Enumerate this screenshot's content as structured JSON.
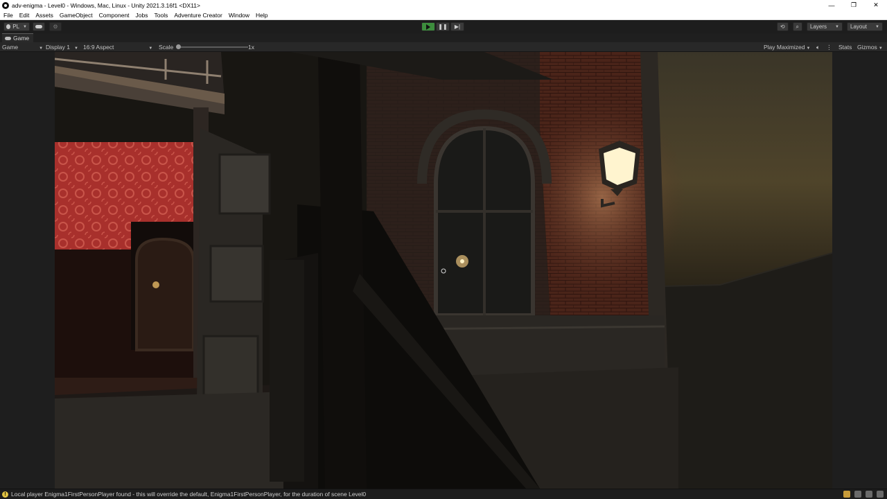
{
  "window": {
    "title": "adv-enigma - Level0 - Windows, Mac, Linux - Unity 2021.3.16f1 <DX11>",
    "controls": [
      "—",
      "❐",
      "✕"
    ]
  },
  "menu": [
    "File",
    "Edit",
    "Assets",
    "GameObject",
    "Component",
    "Jobs",
    "Tools",
    "Adventure Creator",
    "Window",
    "Help"
  ],
  "toolbar": {
    "account_label": "PL",
    "play_icon": "play-icon",
    "pause_icon": "pause-icon",
    "step_icon": "step-icon",
    "layers_label": "Layers",
    "layout_label": "Layout",
    "play_state": "playing"
  },
  "game_panel": {
    "tab_label": "Game",
    "mode_label": "Game",
    "display_label": "Display 1",
    "aspect_label": "16:9 Aspect",
    "scale_label": "Scale",
    "scale_value": "1x",
    "play_mode_label": "Play Maximized",
    "stats_label": "Stats",
    "gizmos_label": "Gizmos"
  },
  "colors": {
    "editor_bg": "#1d1d1d",
    "accent_play": "#3d8d3d",
    "warning": "#e0c242",
    "brick": "#5a2a1e",
    "wallpaper": "#a8302c",
    "lamp_glow": "#fff4cf",
    "sky": "#4f442a"
  },
  "status": {
    "message": "Local player Enigma1FirstPersonPlayer found - this will override the default, Enigma1FirstPersonPlayer, for the duration of scene Level0"
  }
}
